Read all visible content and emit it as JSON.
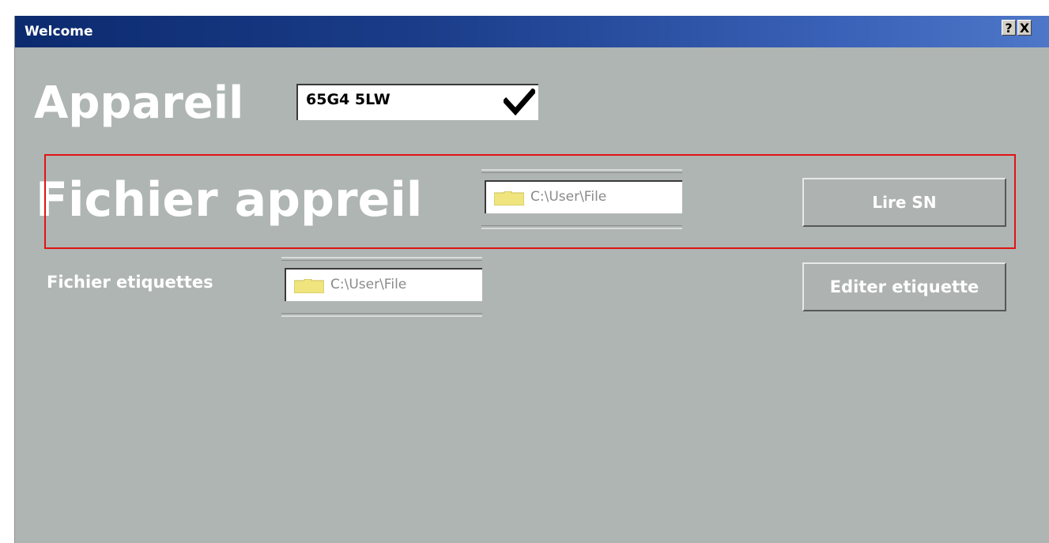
{
  "window": {
    "title": "Welcome",
    "help_label": "?",
    "close_label": "X"
  },
  "appareil": {
    "label": "Appareil",
    "selected_value": "65G4 5LW",
    "dropdown_icon": "check-icon"
  },
  "fichier_appareil": {
    "label": "Fichier appreil",
    "path": "C:\\User\\File",
    "icon": "folder-icon"
  },
  "fichier_etiquettes": {
    "label": "Fichier etiquettes",
    "path": "C:\\User\\File",
    "icon": "folder-icon"
  },
  "buttons": {
    "lire_sn": "Lire SN",
    "editer_etiquette": "Editer etiquette"
  },
  "colors": {
    "titlebar": "#1b3d8a",
    "window_bg": "#afb5b3",
    "highlight": "#e01414",
    "folder": "#efe47e"
  }
}
